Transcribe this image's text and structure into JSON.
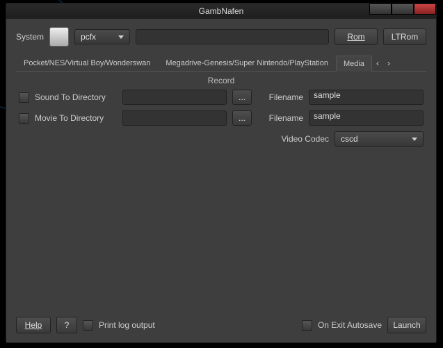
{
  "window": {
    "title": "GambNafen"
  },
  "top": {
    "system_label": "System",
    "system_value": "pcfx",
    "rom_btn": "Rom",
    "ltrom_btn": "LTRom"
  },
  "tabs": [
    "Pocket/NES/Virtual Boy/Wonderswan",
    "Megadrive-Genesis/Super Nintendo/PlayStation",
    "Media"
  ],
  "record": {
    "title": "Record",
    "sound_label": "Sound To Directory",
    "movie_label": "Movie To Directory",
    "browse": "...",
    "filename_label": "Filename",
    "sound_filename": "sample",
    "movie_filename": "sample",
    "codec_label": "Video Codec",
    "codec_value": "cscd"
  },
  "bottom": {
    "help": "Help",
    "question": "?",
    "printlog": "Print log output",
    "autosave": "On Exit Autosave",
    "launch": "Launch"
  }
}
